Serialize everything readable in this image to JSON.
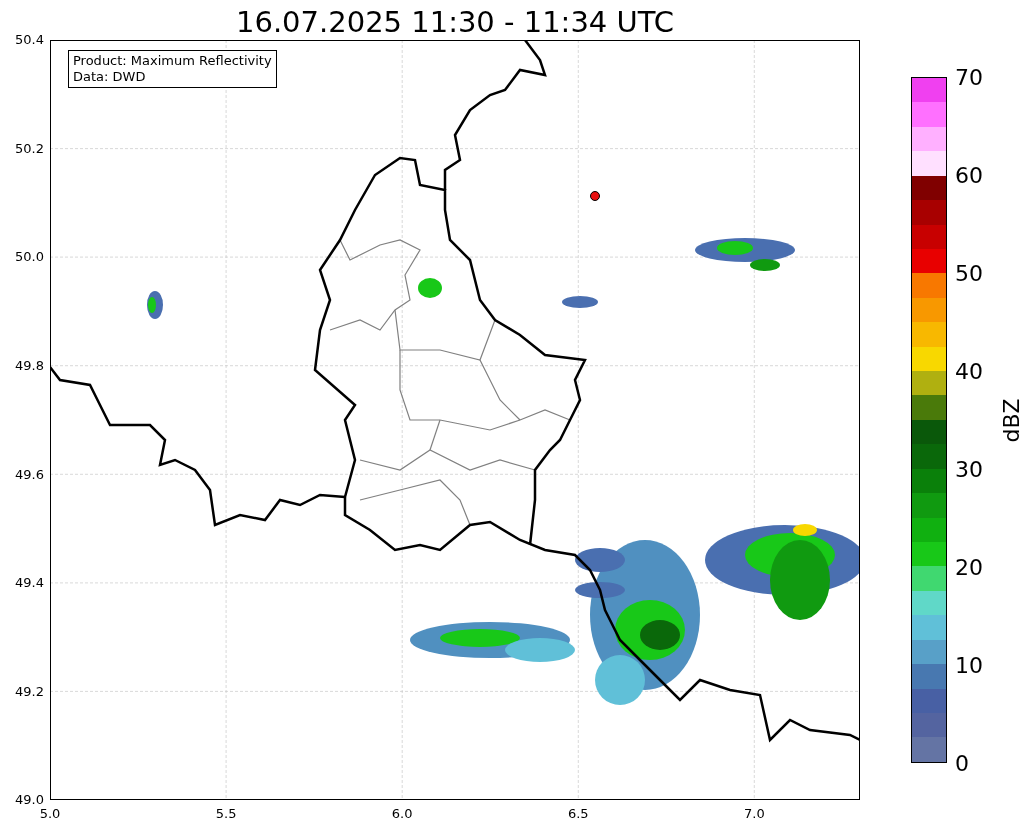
{
  "title": "16.07.2025 11:30 - 11:34 UTC",
  "info_box": {
    "lines": [
      "Product: Maximum Reflectivity",
      "Data: DWD"
    ]
  },
  "y_ticks": [
    "50.4",
    "50.2",
    "50.0",
    "49.8",
    "49.6",
    "49.4",
    "49.2",
    "49.0"
  ],
  "x_ticks": [
    "5.0",
    "5.5",
    "6.0",
    "6.5",
    "7.0"
  ],
  "colorbar": {
    "label": "dBZ",
    "ticks": [
      "70",
      "60",
      "50",
      "40",
      "30",
      "20",
      "10",
      "0"
    ],
    "bins": [
      {
        "color": "#f040f0"
      },
      {
        "color": "#ff70ff"
      },
      {
        "color": "#ffb0ff"
      },
      {
        "color": "#ffe0ff"
      },
      {
        "color": "#800000"
      },
      {
        "color": "#a80000"
      },
      {
        "color": "#c80000"
      },
      {
        "color": "#e80000"
      },
      {
        "color": "#f87800"
      },
      {
        "color": "#f89800"
      },
      {
        "color": "#f8b800"
      },
      {
        "color": "#f8d800"
      },
      {
        "color": "#b0b010"
      },
      {
        "color": "#4a7a0a"
      },
      {
        "color": "#0a580a"
      },
      {
        "color": "#0a680a"
      },
      {
        "color": "#0a800a"
      },
      {
        "color": "#109a10"
      },
      {
        "color": "#10b010"
      },
      {
        "color": "#18c818"
      },
      {
        "color": "#40d870"
      },
      {
        "color": "#60d8c8"
      },
      {
        "color": "#60c0d8"
      },
      {
        "color": "#58a0c8"
      },
      {
        "color": "#4878b0"
      },
      {
        "color": "#4860a4"
      },
      {
        "color": "#5464a0"
      },
      {
        "color": "#6474a4"
      }
    ]
  }
}
